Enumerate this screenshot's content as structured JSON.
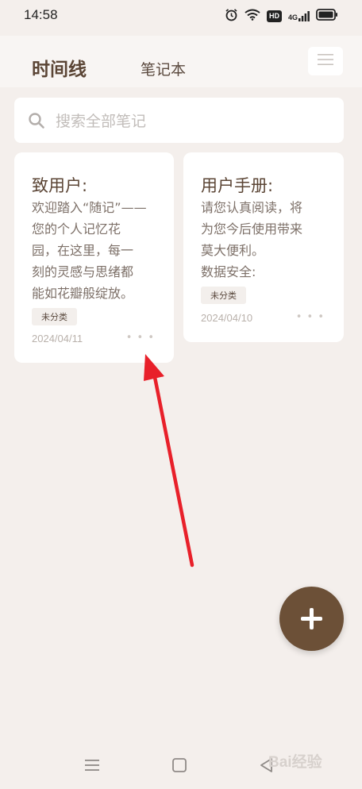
{
  "status_bar": {
    "time": "14:58",
    "hd": "HD",
    "network": "4G"
  },
  "header": {
    "tabs": [
      {
        "label": "时间线",
        "active": true
      },
      {
        "label": "笔记本",
        "active": false
      }
    ],
    "menu_icon": "hamburger-icon"
  },
  "search": {
    "placeholder": "搜索全部笔记",
    "value": "",
    "icon": "search-icon"
  },
  "notes": [
    {
      "title": "致用户:",
      "body": [
        "欢迎踏入“随记”——",
        "您的个人记忆花",
        "园，在这里，每一",
        "刻的灵感与思绪都",
        "能如花瓣般绽放。"
      ],
      "tag": "未分类",
      "date": "2024/04/11",
      "more": "• • •"
    },
    {
      "title": "用户手册:",
      "body": [
        "请您认真阅读，将",
        "为您今后使用带来",
        "莫大便利。",
        "数据安全:"
      ],
      "tag": "未分类",
      "date": "2024/04/10",
      "more": "• • •"
    }
  ],
  "fab": {
    "icon": "plus-icon"
  },
  "nav_bar": {
    "icons": [
      "menu-icon",
      "home-square-icon",
      "back-icon"
    ]
  },
  "watermark": "Bai经验",
  "colors": {
    "accent": "#6c5037",
    "background": "#f4efec",
    "arrow": "#e8202a"
  }
}
